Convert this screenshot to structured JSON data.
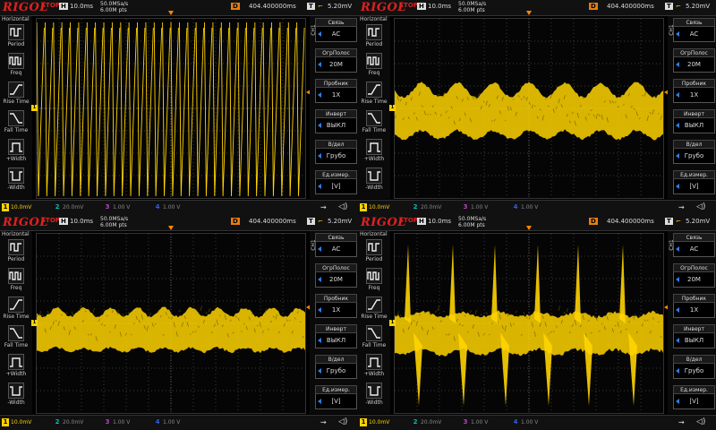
{
  "shared": {
    "logo": "RIGOL",
    "status": "STOP",
    "h_badge": "H",
    "h_value": "10.0ms",
    "sample_rate": "50.0MSa/s",
    "mem_depth": "6.00M pts",
    "d_badge": "D",
    "delay": "404.400000ms",
    "t_badge": "T",
    "trig_level": "5.20mV",
    "sidebar_header": "Horizontal",
    "measure_items": [
      {
        "label": "Period",
        "icon": "period-icon"
      },
      {
        "label": "Freq",
        "icon": "freq-icon"
      },
      {
        "label": "Rise Time",
        "icon": "rise-time-icon"
      },
      {
        "label": "Fall Time",
        "icon": "fall-time-icon"
      },
      {
        "label": "+Width",
        "icon": "pos-width-icon"
      },
      {
        "label": "-Width",
        "icon": "neg-width-icon"
      }
    ],
    "channel_label": "CH1",
    "menu": [
      {
        "title": "Связь",
        "value": "AC"
      },
      {
        "title": "ОгрПолос",
        "value": "20M"
      },
      {
        "title": "Пробник",
        "value": "1X"
      },
      {
        "title": "Инверт",
        "value": "ВЫКЛ"
      },
      {
        "title": "В/дел",
        "value": "Грубо"
      },
      {
        "title": "Ед.измер.",
        "value": "[V]"
      }
    ],
    "channels": [
      {
        "num": "1",
        "value": "10.0mV"
      },
      {
        "num": "2",
        "value": "20.0mV"
      },
      {
        "num": "3",
        "value": "1.00 V"
      },
      {
        "num": "4",
        "value": "1.00 V"
      }
    ],
    "ch1_marker": "1",
    "colors": {
      "trace": "#ffd400",
      "logo": "#e02020",
      "grid": "#3a3a3a",
      "trigger": "#ff8800"
    }
  },
  "panels": [
    {
      "id": "top-left",
      "waveform": "sawtooth-dense"
    },
    {
      "id": "top-right",
      "waveform": "noise-band-wavy"
    },
    {
      "id": "bottom-left",
      "waveform": "noise-band-ripple"
    },
    {
      "id": "bottom-right",
      "waveform": "noise-band-spikes"
    }
  ]
}
